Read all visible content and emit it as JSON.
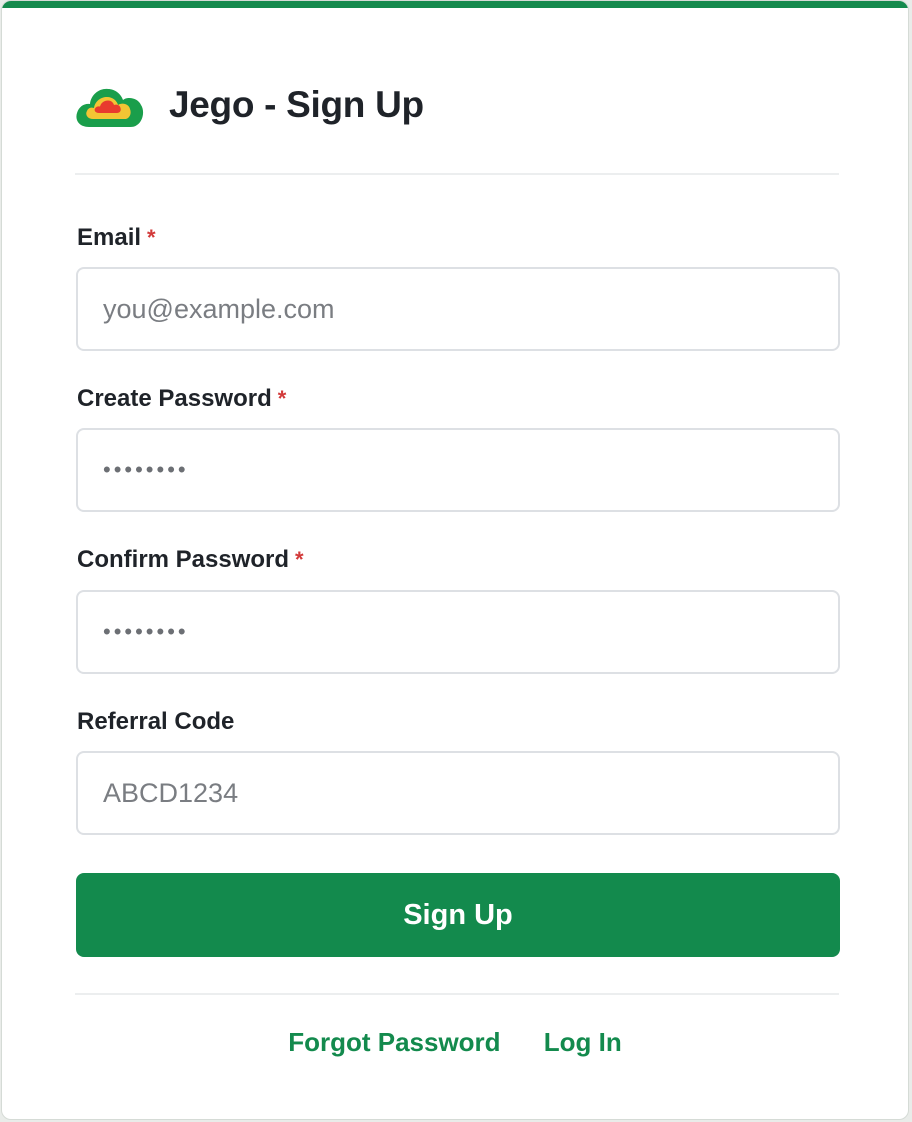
{
  "header": {
    "title": "Jego - Sign Up",
    "logo_icon": "cloud-logo-icon"
  },
  "form": {
    "email": {
      "label": "Email",
      "required_marker": "*",
      "placeholder": "you@example.com",
      "value": ""
    },
    "create_password": {
      "label": "Create Password",
      "required_marker": "*",
      "placeholder": "••••••••",
      "value": ""
    },
    "confirm_password": {
      "label": "Confirm Password",
      "required_marker": "*",
      "placeholder": "••••••••",
      "value": ""
    },
    "referral_code": {
      "label": "Referral Code",
      "placeholder": "ABCD1234",
      "value": ""
    },
    "submit_label": "Sign Up"
  },
  "footer": {
    "forgot_password_label": "Forgot Password",
    "login_label": "Log In"
  },
  "colors": {
    "brand_green": "#138a4d",
    "required_red": "#d23a3a",
    "text_dark": "#1f2329"
  }
}
